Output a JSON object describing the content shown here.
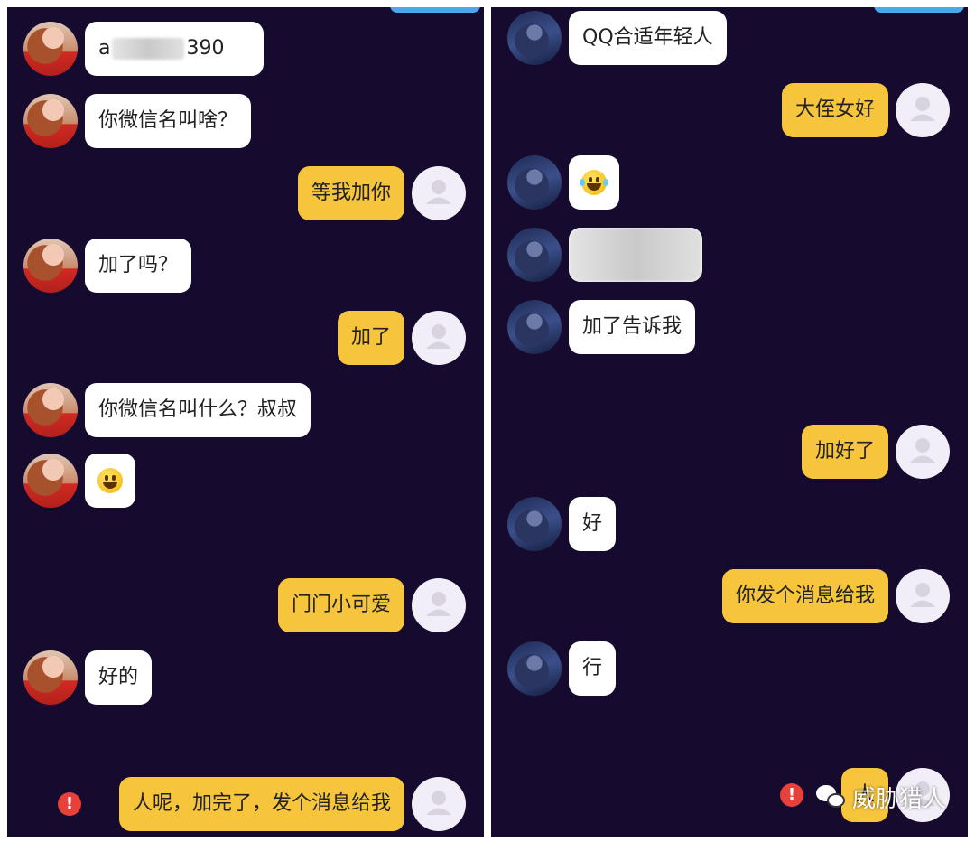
{
  "left_chat": {
    "messages": [
      {
        "side": "in",
        "text_prefix": "a",
        "text_suffix": "390"
      },
      {
        "side": "in",
        "text": "你微信名叫啥？"
      },
      {
        "side": "out",
        "text": "等我加你"
      },
      {
        "side": "in",
        "text": "加了吗？"
      },
      {
        "side": "out",
        "text": "加了"
      },
      {
        "side": "in",
        "text": "你微信名叫什么？叔叔"
      },
      {
        "side": "in",
        "emoji": "grinning-face"
      },
      {
        "side": "out",
        "text": "门门小可爱"
      },
      {
        "side": "in",
        "text": "好的"
      },
      {
        "side": "out",
        "text": "人呢，加完了，发个消息给我",
        "status": "failed"
      }
    ],
    "failed_mark": "!"
  },
  "right_chat": {
    "messages": [
      {
        "side": "in",
        "text": "QQ合适年轻人"
      },
      {
        "side": "out",
        "text": "大侄女好"
      },
      {
        "side": "in",
        "emoji": "face-with-tears-of-joy"
      },
      {
        "side": "in",
        "blurred": true
      },
      {
        "side": "in",
        "text": "加了告诉我"
      },
      {
        "side": "out",
        "text": "加好了"
      },
      {
        "side": "in",
        "text": "好"
      },
      {
        "side": "out",
        "text": "你发个消息给我"
      },
      {
        "side": "in",
        "text": "行"
      },
      {
        "side": "out",
        "text": "人",
        "status": "failed"
      }
    ],
    "failed_mark": "!"
  },
  "watermark": {
    "text": "威胁猎人",
    "icon": "wechat-icon"
  },
  "colors": {
    "background": "#160a2e",
    "incoming_bubble": "#ffffff",
    "outgoing_bubble": "#f7c53c",
    "error": "#e8413a"
  }
}
